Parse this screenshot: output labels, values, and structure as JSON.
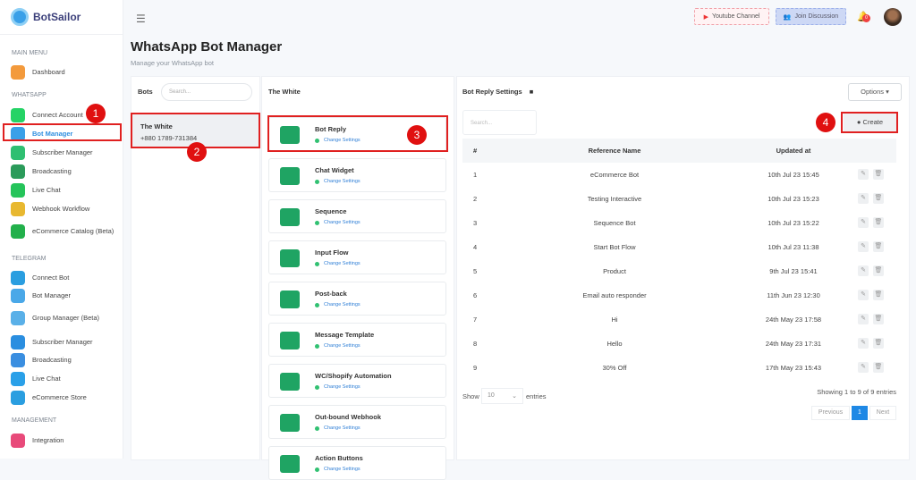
{
  "brand": {
    "name": "BotSailor"
  },
  "sidebar": {
    "sections": [
      {
        "title": "MAIN MENU",
        "items": [
          {
            "label": "Dashboard"
          }
        ]
      },
      {
        "title": "WHATSAPP",
        "items": [
          {
            "label": "Connect Account"
          },
          {
            "label": "Bot Manager"
          },
          {
            "label": "Subscriber Manager"
          },
          {
            "label": "Broadcasting"
          },
          {
            "label": "Live Chat"
          },
          {
            "label": "Webhook Workflow"
          },
          {
            "label": "eCommerce Catalog (Beta)"
          }
        ]
      },
      {
        "title": "TELEGRAM",
        "items": [
          {
            "label": "Connect Bot"
          },
          {
            "label": "Bot Manager"
          },
          {
            "label": "Group Manager (Beta)"
          },
          {
            "label": "Subscriber Manager"
          },
          {
            "label": "Broadcasting"
          },
          {
            "label": "Live Chat"
          },
          {
            "label": "eCommerce Store"
          }
        ]
      },
      {
        "title": "MANAGEMENT",
        "items": [
          {
            "label": "Integration"
          }
        ]
      }
    ]
  },
  "header": {
    "youtube": "Youtube Channel",
    "join": "Join Discussion",
    "notifications": "0"
  },
  "page": {
    "title": "WhatsApp Bot Manager",
    "subtitle": "Manage your WhatsApp bot"
  },
  "bots": {
    "label": "Bots",
    "search_placeholder": "Search...",
    "items": [
      {
        "name": "The White",
        "phone": "+880 1789-731384"
      }
    ]
  },
  "features": {
    "title": "The White",
    "link": "Change Settings",
    "items": [
      "Bot Reply",
      "Chat Widget",
      "Sequence",
      "Input Flow",
      "Post-back",
      "Message Template",
      "WC/Shopify Automation",
      "Out-bound Webhook",
      "Action Buttons"
    ]
  },
  "settings": {
    "title": "Bot Reply Settings",
    "options": "Options",
    "create": "Create",
    "search_placeholder": "Search...",
    "columns": [
      "#",
      "Reference Name",
      "Updated at"
    ],
    "rows": [
      [
        "1",
        "eCommerce Bot",
        "10th Jul 23 15:45"
      ],
      [
        "2",
        "Testing Interactive",
        "10th Jul 23 15:23"
      ],
      [
        "3",
        "Sequence Bot",
        "10th Jul 23 15:22"
      ],
      [
        "4",
        "Start Bot Flow",
        "10th Jul 23 11:38"
      ],
      [
        "5",
        "Product",
        "9th Jul 23 15:41"
      ],
      [
        "6",
        "Email auto responder",
        "11th Jun 23 12:30"
      ],
      [
        "7",
        "Hi",
        "24th May 23 17:58"
      ],
      [
        "8",
        "Hello",
        "24th May 23 17:31"
      ],
      [
        "9",
        "30% Off",
        "17th May 23 15:43"
      ]
    ],
    "show": "Show",
    "entries_value": "10",
    "entries": "entries",
    "info": "Showing 1 to 9 of 9 entries",
    "prev": "Previous",
    "page": "1",
    "next": "Next"
  },
  "annotations": [
    "1",
    "2",
    "3",
    "4"
  ],
  "colors": {
    "accent": "#1fa463",
    "link": "#2f8fe0",
    "annotation": "#e01010"
  }
}
